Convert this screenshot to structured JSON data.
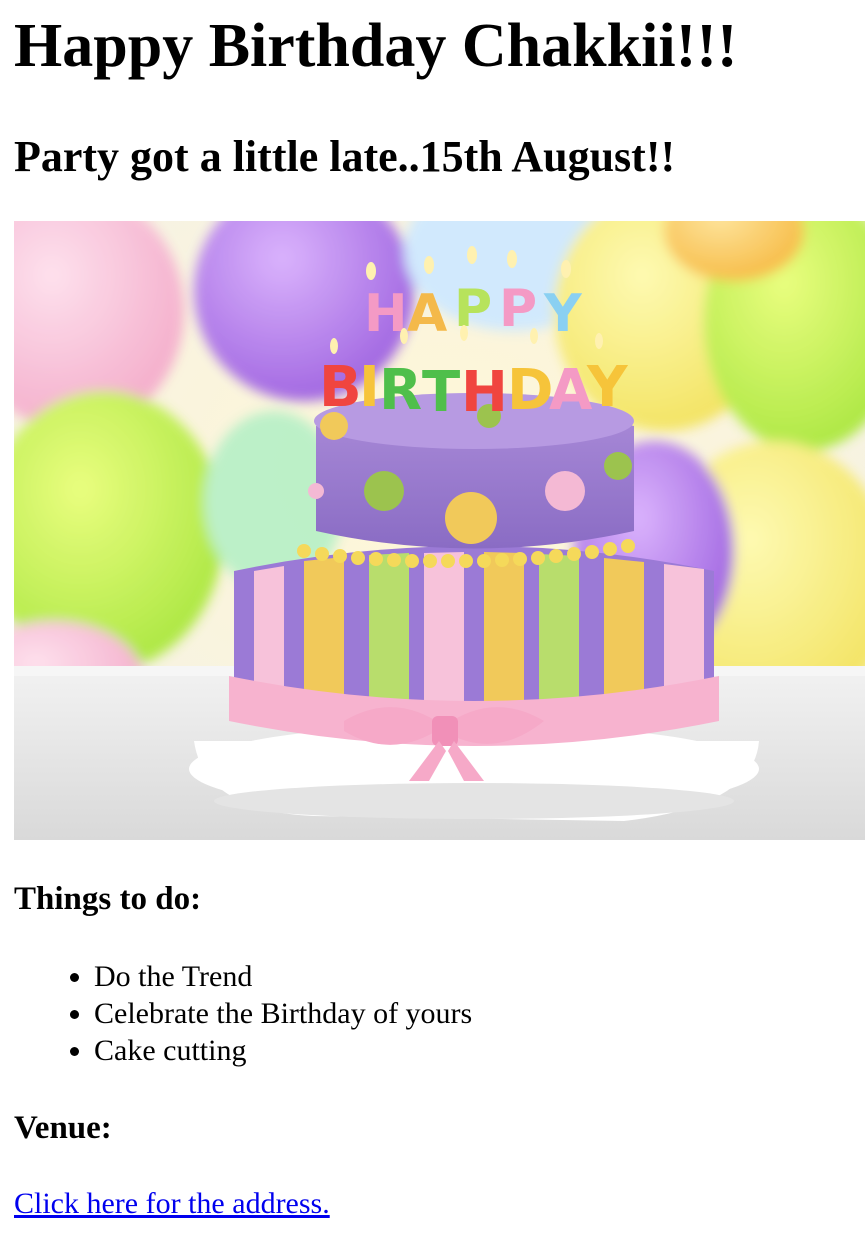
{
  "page": {
    "title": "Happy Birthday Chakkii!!!",
    "subtitle": "Party got a little late..15th August!!"
  },
  "hero_image": {
    "alt": "Birthday cake with HAPPY BIRTHDAY candles",
    "candle_text_top": "HAPPY",
    "candle_text_bottom": "BIRTHDAY"
  },
  "todo": {
    "heading": "Things to do:",
    "items": [
      "Do the Trend",
      "Celebrate the Birthday of yours",
      "Cake cutting"
    ]
  },
  "venue": {
    "heading": "Venue:",
    "link_text": "Click here for the address."
  },
  "colors": {
    "link": "#0000ee",
    "text": "#000000",
    "background": "#ffffff"
  }
}
